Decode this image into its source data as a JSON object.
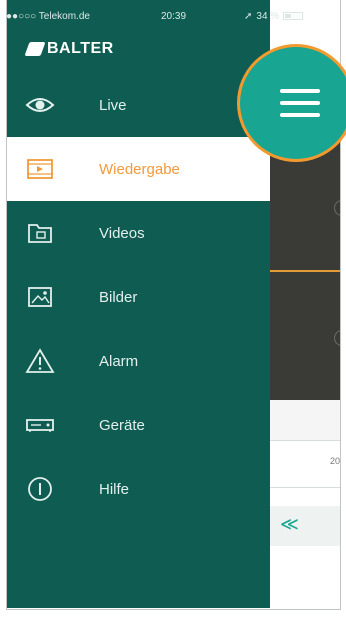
{
  "status": {
    "carrier": "●●○○○ Telekom.de",
    "time": "20:39",
    "battery": "34 %",
    "battery_level": 0.34
  },
  "brand": "BALTER",
  "menu": [
    {
      "label": "Live",
      "icon": "eye-icon",
      "active": false
    },
    {
      "label": "Wiedergabe",
      "icon": "playback-icon",
      "active": true
    },
    {
      "label": "Videos",
      "icon": "folder-video-icon",
      "active": false
    },
    {
      "label": "Bilder",
      "icon": "image-icon",
      "active": false
    },
    {
      "label": "Alarm",
      "icon": "alarm-triangle-icon",
      "active": false
    },
    {
      "label": "Geräte",
      "icon": "device-icon",
      "active": false
    },
    {
      "label": "Hilfe",
      "icon": "info-icon",
      "active": false
    }
  ],
  "content": {
    "row_text": "20"
  },
  "colors": {
    "sidebar": "#0f5d52",
    "accent": "#f29a3b",
    "teal": "#18a692"
  }
}
